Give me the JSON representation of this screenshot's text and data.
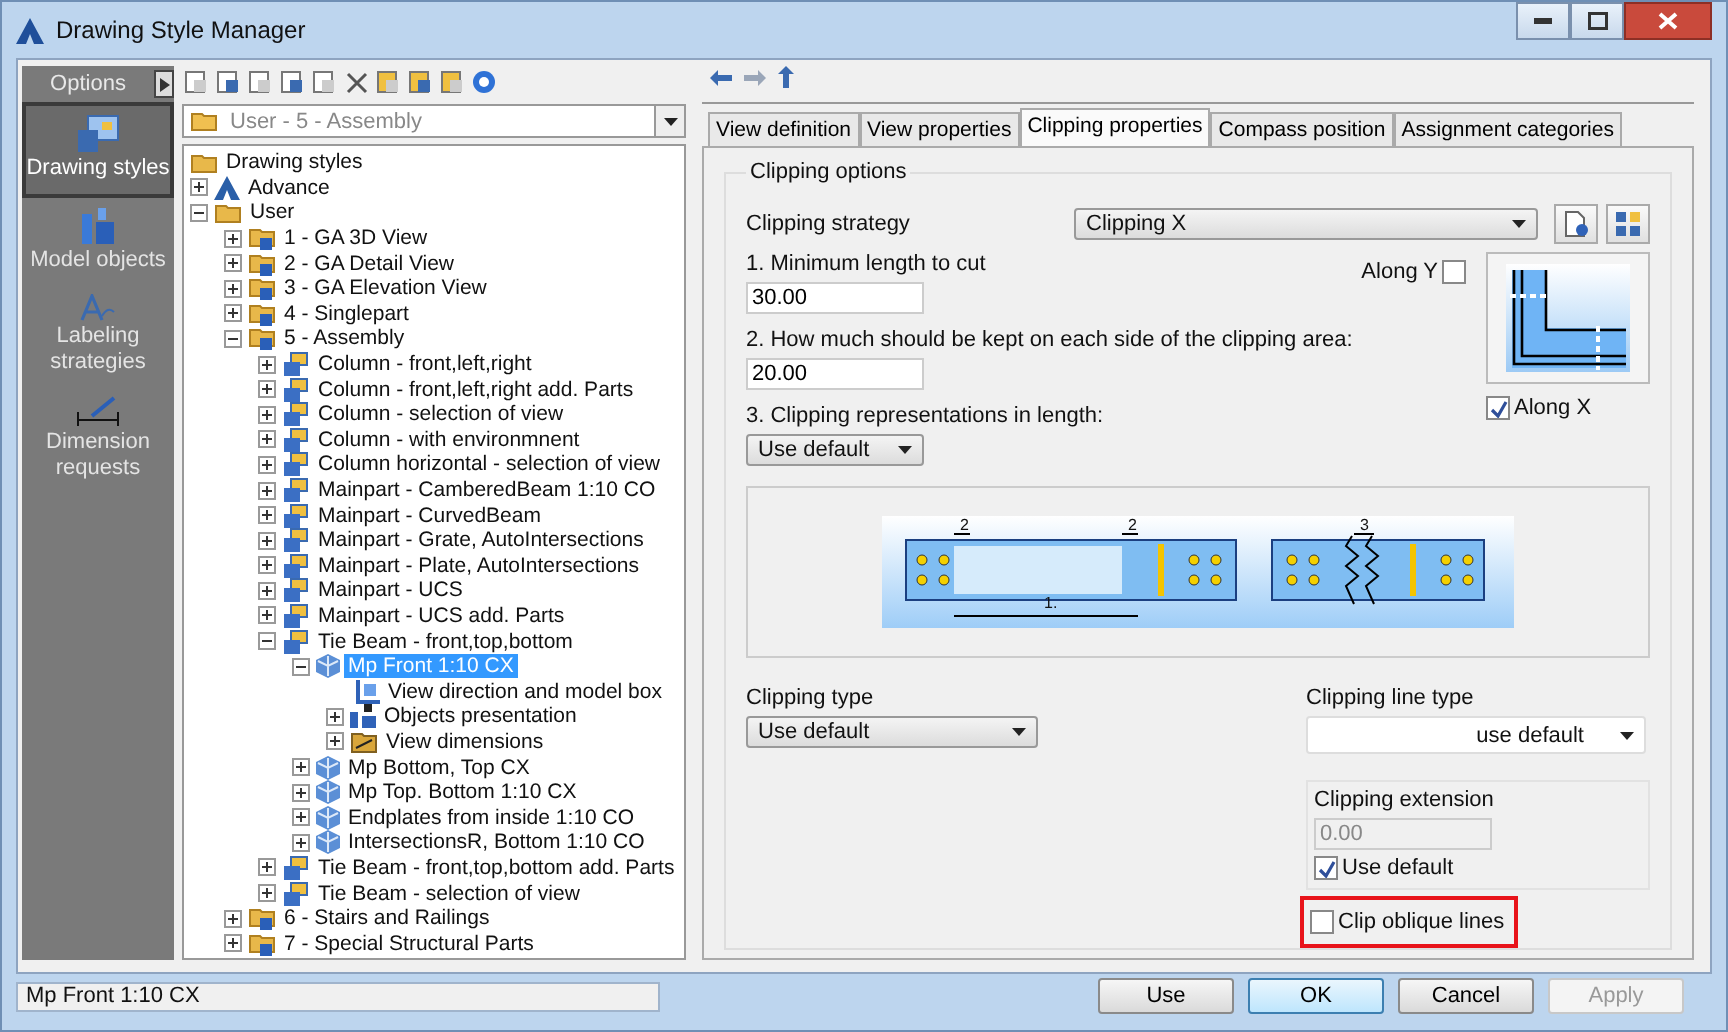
{
  "window": {
    "title": "Drawing Style Manager"
  },
  "sidebar": {
    "header": "Options",
    "items": [
      {
        "label": "Drawing styles",
        "kind": "styles",
        "selected": true
      },
      {
        "label": "Model objects",
        "kind": "objects",
        "selected": false
      },
      {
        "label": "Labeling strategies",
        "kind": "labeling",
        "selected": false
      },
      {
        "label": "Dimension requests",
        "kind": "dimension",
        "selected": false
      }
    ]
  },
  "style_selector": {
    "value": "User - 5 - Assembly"
  },
  "tree": {
    "label": "Drawing styles",
    "kind": "folder",
    "children": [
      {
        "label": "Advance",
        "kind": "logo",
        "expanded": false,
        "selected": false
      },
      {
        "label": "User",
        "kind": "folder",
        "expanded": true,
        "selected": false,
        "children": [
          {
            "label": "1 - GA 3D View",
            "kind": "group",
            "expanded": false,
            "selected": false
          },
          {
            "label": "2 - GA Detail View",
            "kind": "group",
            "expanded": false,
            "selected": false
          },
          {
            "label": "3 - GA Elevation View",
            "kind": "group",
            "expanded": false,
            "selected": false
          },
          {
            "label": "4 - Singlepart",
            "kind": "group",
            "expanded": false,
            "selected": false
          },
          {
            "label": "5 - Assembly",
            "kind": "group",
            "expanded": true,
            "selected": false,
            "children": [
              {
                "label": "Column - front,left,right",
                "kind": "style",
                "expanded": false,
                "selected": false
              },
              {
                "label": "Column - front,left,right add. Parts",
                "kind": "style",
                "expanded": false,
                "selected": false
              },
              {
                "label": "Column - selection of view",
                "kind": "style",
                "expanded": false,
                "selected": false
              },
              {
                "label": "Column - with environmnent",
                "kind": "style",
                "expanded": false,
                "selected": false
              },
              {
                "label": "Column horizontal - selection of view",
                "kind": "style",
                "expanded": false,
                "selected": false
              },
              {
                "label": "Mainpart - CamberedBeam 1:10 CO",
                "kind": "style",
                "expanded": false,
                "selected": false
              },
              {
                "label": "Mainpart - CurvedBeam",
                "kind": "style",
                "expanded": false,
                "selected": false
              },
              {
                "label": "Mainpart - Grate, AutoIntersections",
                "kind": "style",
                "expanded": false,
                "selected": false
              },
              {
                "label": "Mainpart - Plate, AutoIntersections",
                "kind": "style",
                "expanded": false,
                "selected": false
              },
              {
                "label": "Mainpart - UCS",
                "kind": "style",
                "expanded": false,
                "selected": false
              },
              {
                "label": "Mainpart - UCS add. Parts",
                "kind": "style",
                "expanded": false,
                "selected": false
              },
              {
                "label": "Tie Beam - front,top,bottom",
                "kind": "style",
                "expanded": true,
                "selected": false,
                "children": [
                  {
                    "label": "Mp Front 1:10 CX",
                    "kind": "view",
                    "expanded": true,
                    "selected": true,
                    "children": [
                      {
                        "label": "View direction and model box",
                        "kind": "direction",
                        "selected": false
                      },
                      {
                        "label": "Objects presentation",
                        "kind": "objects",
                        "expanded": false,
                        "selected": false
                      },
                      {
                        "label": "View dimensions",
                        "kind": "dims",
                        "expanded": false,
                        "selected": false
                      }
                    ]
                  },
                  {
                    "label": "Mp Bottom, Top CX",
                    "kind": "view",
                    "expanded": false,
                    "selected": false
                  },
                  {
                    "label": "Mp Top. Bottom 1:10 CX",
                    "kind": "view",
                    "expanded": false,
                    "selected": false
                  },
                  {
                    "label": "Endplates from inside 1:10 CO",
                    "kind": "view",
                    "expanded": false,
                    "selected": false
                  },
                  {
                    "label": "IntersectionsR, Bottom 1:10 CO",
                    "kind": "view",
                    "expanded": false,
                    "selected": false
                  }
                ]
              },
              {
                "label": "Tie Beam - front,top,bottom add. Parts",
                "kind": "style",
                "expanded": false,
                "selected": false
              },
              {
                "label": "Tie Beam - selection of view",
                "kind": "style",
                "expanded": false,
                "selected": false
              }
            ]
          },
          {
            "label": "6 - Stairs and Railings",
            "kind": "group",
            "expanded": false,
            "selected": false
          },
          {
            "label": "7 - Special Structural Parts",
            "kind": "group",
            "expanded": false,
            "selected": false
          }
        ]
      }
    ]
  },
  "tabs": [
    {
      "label": "View definition",
      "selected": false
    },
    {
      "label": "View properties",
      "selected": false
    },
    {
      "label": "Clipping properties",
      "selected": true
    },
    {
      "label": "Compass position",
      "selected": false
    },
    {
      "label": "Assignment categories",
      "selected": false
    }
  ],
  "clipping_options": {
    "title": "Clipping options",
    "strategy": {
      "label": "Clipping strategy",
      "value": "Clipping X"
    },
    "min_length": {
      "label": "1. Minimum length to cut",
      "value": "30.00"
    },
    "kept_each_side": {
      "label": "2. How much should be kept on each side of the clipping area:",
      "value": "20.00"
    },
    "representations": {
      "label": "3. Clipping representations in length:",
      "value": "Use default"
    },
    "along_y": {
      "label": "Along Y",
      "checked": false
    },
    "along_x": {
      "label": "Along X",
      "checked": true
    },
    "diagram_labels": [
      "2",
      "2",
      "1.",
      "3"
    ],
    "clipping_type": {
      "label": "Clipping type",
      "value": "Use default"
    },
    "clipping_line_type": {
      "label": "Clipping line type",
      "value": "use default"
    },
    "extension": {
      "label": "Clipping extension",
      "value": "0.00",
      "disabled": true,
      "use_default": {
        "label": "Use default",
        "checked": true
      }
    },
    "clip_oblique": {
      "label": "Clip oblique lines",
      "checked": false,
      "highlighted": true
    }
  },
  "status_bar": {
    "text": "Mp Front 1:10 CX"
  },
  "buttons": [
    {
      "label": "Use",
      "default": false,
      "disabled": false
    },
    {
      "label": "OK",
      "default": true,
      "disabled": false
    },
    {
      "label": "Cancel",
      "default": false,
      "disabled": false
    },
    {
      "label": "Apply",
      "default": false,
      "disabled": true
    }
  ]
}
